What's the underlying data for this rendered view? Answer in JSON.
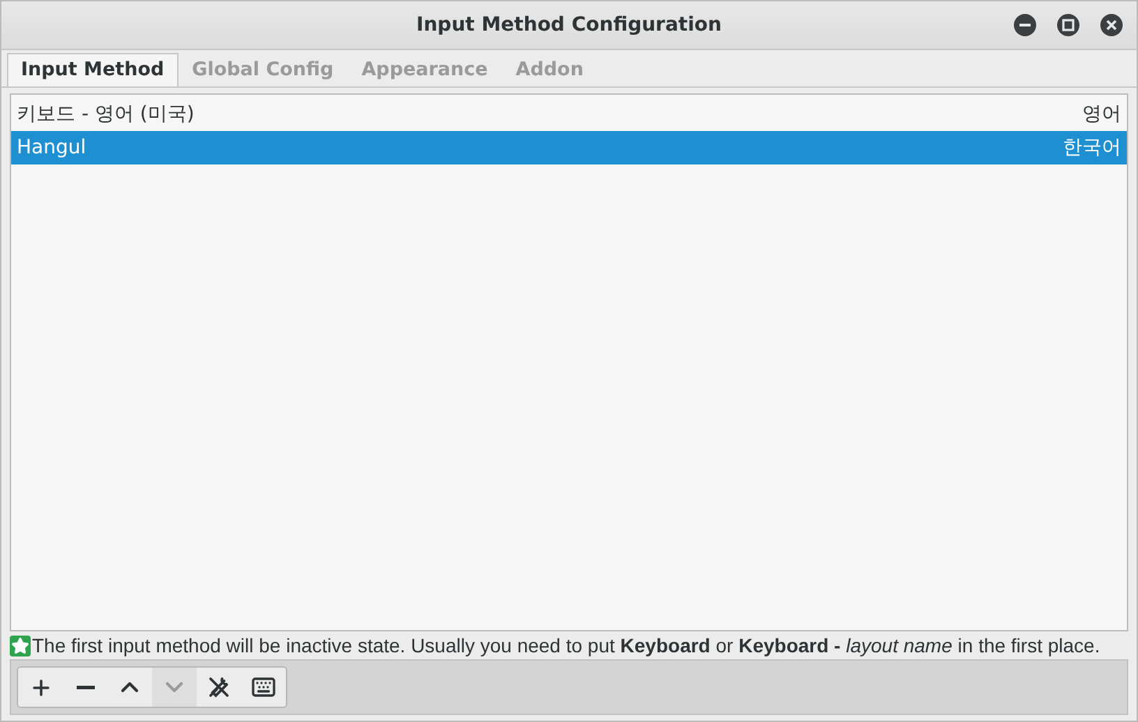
{
  "window": {
    "title": "Input Method Configuration"
  },
  "tabs": [
    {
      "label": "Input Method",
      "selected": true
    },
    {
      "label": "Global Config",
      "selected": false
    },
    {
      "label": "Appearance",
      "selected": false
    },
    {
      "label": "Addon",
      "selected": false
    }
  ],
  "input_methods": [
    {
      "name": "키보드 - 영어 (미국)",
      "language": "영어",
      "selected": false
    },
    {
      "name": "Hangul",
      "language": "한국어",
      "selected": true
    }
  ],
  "hint": "The first input method will be inactive state. Usually you need to put **Keyboard** or **Keyboard -** *layout name* in the first place.",
  "toolbar": [
    {
      "kind": "add",
      "disabled": false
    },
    {
      "kind": "remove",
      "disabled": false
    },
    {
      "kind": "up",
      "disabled": false
    },
    {
      "kind": "down",
      "disabled": true
    },
    {
      "kind": "configure",
      "disabled": false
    },
    {
      "kind": "keyboard",
      "disabled": false
    }
  ]
}
